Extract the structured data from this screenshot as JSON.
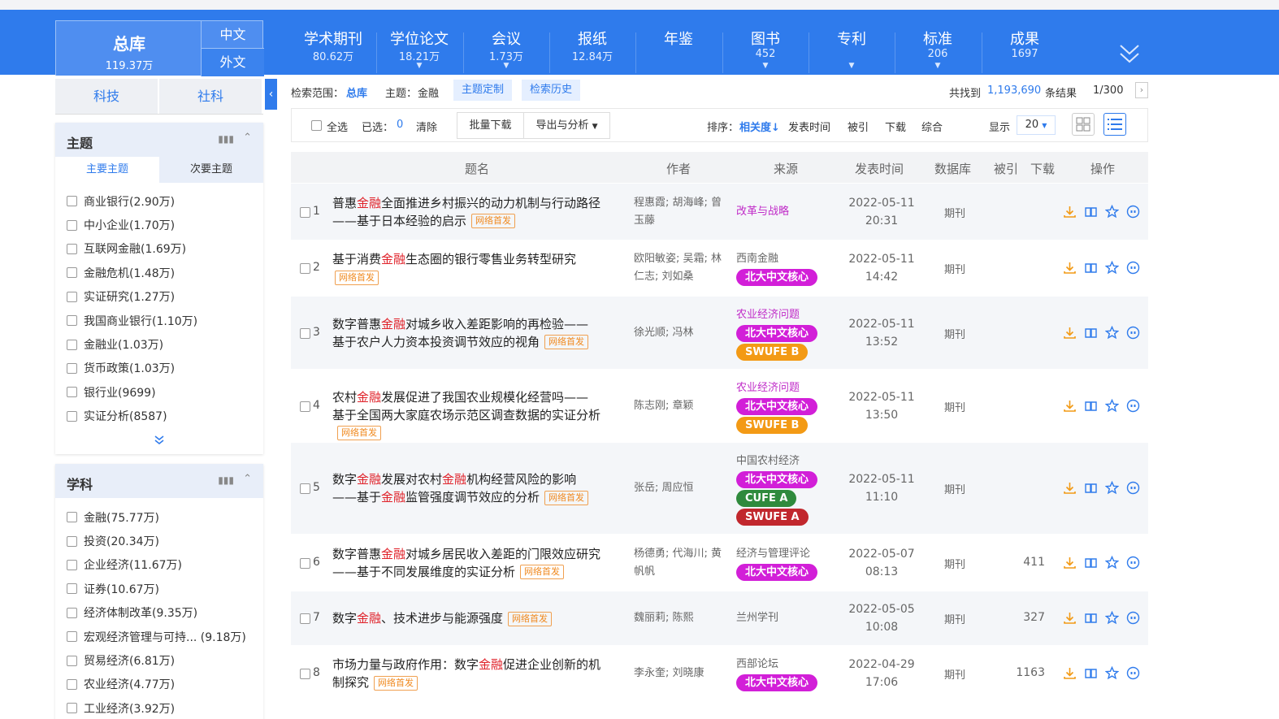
{
  "nav": {
    "main_db": {
      "label": "总库",
      "count": "119.37万"
    },
    "lang_zh": "中文",
    "lang_wai": "外文",
    "items": [
      {
        "label": "学术期刊",
        "count": "80.62万",
        "has_caret": false
      },
      {
        "label": "学位论文",
        "count": "18.21万",
        "has_caret": true
      },
      {
        "label": "会议",
        "count": "1.73万",
        "has_caret": true
      },
      {
        "label": "报纸",
        "count": "12.84万",
        "has_caret": false
      },
      {
        "label": "年鉴",
        "count": "",
        "has_caret": false
      },
      {
        "label": "图书",
        "count": "452",
        "has_caret": true
      },
      {
        "label": "专利",
        "count": "",
        "has_caret": true
      },
      {
        "label": "标准",
        "count": "206",
        "has_caret": true
      },
      {
        "label": "成果",
        "count": "1697",
        "has_caret": false
      }
    ]
  },
  "sidebar": {
    "tabs": [
      "科技",
      "社科"
    ],
    "collapse_icon": "chevron-left-icon",
    "topic_panel": {
      "title": "主题",
      "subtabs": [
        "主要主题",
        "次要主题"
      ],
      "items": [
        "商业银行(2.90万)",
        "中小企业(1.70万)",
        "互联网金融(1.69万)",
        "金融危机(1.48万)",
        "实证研究(1.27万)",
        "我国商业银行(1.10万)",
        "金融业(1.03万)",
        "货币政策(1.03万)",
        "银行业(9699)",
        "实证分析(8587)"
      ]
    },
    "subject_panel": {
      "title": "学科",
      "items": [
        "金融(75.77万)",
        "投资(20.34万)",
        "企业经济(11.67万)",
        "证券(10.67万)",
        "经济体制改革(9.35万)",
        "宏观经济管理与可持... (9.18万)",
        "贸易经济(6.81万)",
        "农业经济(4.77万)",
        "工业经济(3.92万)"
      ]
    }
  },
  "scope": {
    "label": "检索范围：",
    "db": "总库",
    "topic_label": "主题：",
    "topic_value": "金融",
    "btn_custom": "主题定制",
    "btn_history": "检索历史",
    "found_prefix": "共找到",
    "found_count": "1,193,690",
    "found_suffix": "条结果",
    "page": "1/300"
  },
  "toolbar": {
    "select_all": "全选",
    "selected_label": "已选：",
    "selected_count": "0",
    "clear": "清除",
    "batch_download": "批量下载",
    "export": "导出与分析",
    "sort_label": "排序：",
    "sort_relevance": "相关度",
    "sort_date": "发表时间",
    "sort_cited": "被引",
    "sort_download": "下载",
    "sort_combined": "综合",
    "display_label": "显示",
    "page_size": "20"
  },
  "table": {
    "headers": [
      "题名",
      "作者",
      "来源",
      "发表时间",
      "数据库",
      "被引",
      "下载",
      "操作"
    ],
    "net_first": "网络首发",
    "db_type": "期刊"
  },
  "rows": [
    {
      "num": "1",
      "title_lines": [
        [
          "普惠",
          "金融",
          "全面推进乡村振兴的动力机制与行动路径"
        ],
        [
          "——基于日本经验的启示"
        ]
      ],
      "authors": "程惠霞; 胡海峰; 曾玉藤",
      "source": "改革与战略",
      "tags": [],
      "date": "2022-05-11",
      "time": "20:31",
      "downloads": "",
      "source_color": "#c02cc8"
    },
    {
      "num": "2",
      "title_lines": [
        [
          "基于消费",
          "金融",
          "生态圈的银行零售业务转型研究"
        ],
        [
          ""
        ]
      ],
      "authors": "欧阳敏姿; 吴霜; 林仁志; 刘如桑",
      "source": "西南金融",
      "tags": [
        "北大中文核心"
      ],
      "date": "2022-05-11",
      "time": "14:42",
      "downloads": "",
      "source_color": "#666666"
    },
    {
      "num": "3",
      "title_lines": [
        [
          "数字普惠",
          "金融",
          "对城乡收入差距影响的再检验——"
        ],
        [
          "基于农户人力资本投资调节效应的视角"
        ]
      ],
      "authors": "徐光顺; 冯林",
      "source": "农业经济问题",
      "tags": [
        "北大中文核心",
        "SWUFE B"
      ],
      "date": "2022-05-11",
      "time": "13:52",
      "downloads": "",
      "source_color": "#c02cc8"
    },
    {
      "num": "4",
      "title_lines": [
        [
          "农村",
          "金融",
          "发展促进了我国农业规模化经营吗——"
        ],
        [
          "基于全国两大家庭农场示范区调查数据的实证分析"
        ]
      ],
      "authors": "陈志刚; 章颖",
      "source": "农业经济问题",
      "tags": [
        "北大中文核心",
        "SWUFE B"
      ],
      "date": "2022-05-11",
      "time": "13:50",
      "downloads": "",
      "source_color": "#c02cc8"
    },
    {
      "num": "5",
      "title_lines": [
        [
          "数字",
          "金融",
          "发展对农村",
          "金融",
          "机构经营风险的影响"
        ],
        [
          "——基于",
          "金融",
          "监管强度调节效应的分析"
        ]
      ],
      "authors": "张岳; 周应恒",
      "source": "中国农村经济",
      "tags": [
        "北大中文核心",
        "CUFE A",
        "SWUFE A"
      ],
      "date": "2022-05-11",
      "time": "11:10",
      "downloads": "",
      "source_color": "#666666"
    },
    {
      "num": "6",
      "title_lines": [
        [
          "数字普惠",
          "金融",
          "对城乡居民收入差距的门限效应研究"
        ],
        [
          "——基于不同发展维度的实证分析"
        ]
      ],
      "authors": "杨德勇; 代海川; 黄帆帆",
      "source": "经济与管理评论",
      "tags": [
        "北大中文核心"
      ],
      "date": "2022-05-07",
      "time": "08:13",
      "downloads": "411",
      "source_color": "#666666"
    },
    {
      "num": "7",
      "title_lines": [
        [
          "数字",
          "金融",
          "、技术进步与能源强度"
        ]
      ],
      "authors": "魏丽莉; 陈熙",
      "source": "兰州学刊",
      "tags": [],
      "date": "2022-05-05",
      "time": "10:08",
      "downloads": "327",
      "source_color": "#666666"
    },
    {
      "num": "8",
      "title_lines": [
        [
          "市场力量与政府作用：数字",
          "金融",
          "促进企业创新的机"
        ],
        [
          "制探究"
        ]
      ],
      "authors": "李永奎; 刘晓康",
      "source": "西部论坛",
      "tags": [
        "北大中文核心"
      ],
      "date": "2022-04-29",
      "time": "17:06",
      "downloads": "1163",
      "source_color": "#666666"
    }
  ],
  "colors": {
    "nav_blue": "#2f7bec",
    "highlight_red": "#e0222a",
    "pku_core_tag": "#d21fd8",
    "swufe_b_tag": "#f39a15",
    "cufe_a_tag": "#2f8a3d",
    "swufe_a_tag": "#c1272d"
  },
  "icons": [
    "download-icon",
    "read-icon",
    "html-read-icon",
    "favorite-star-icon",
    "quote-icon",
    "expand-icon",
    "grid-view-icon",
    "list-view-icon",
    "bar-chart-icon",
    "chevron-up-icon",
    "chevron-down-double-icon"
  ]
}
